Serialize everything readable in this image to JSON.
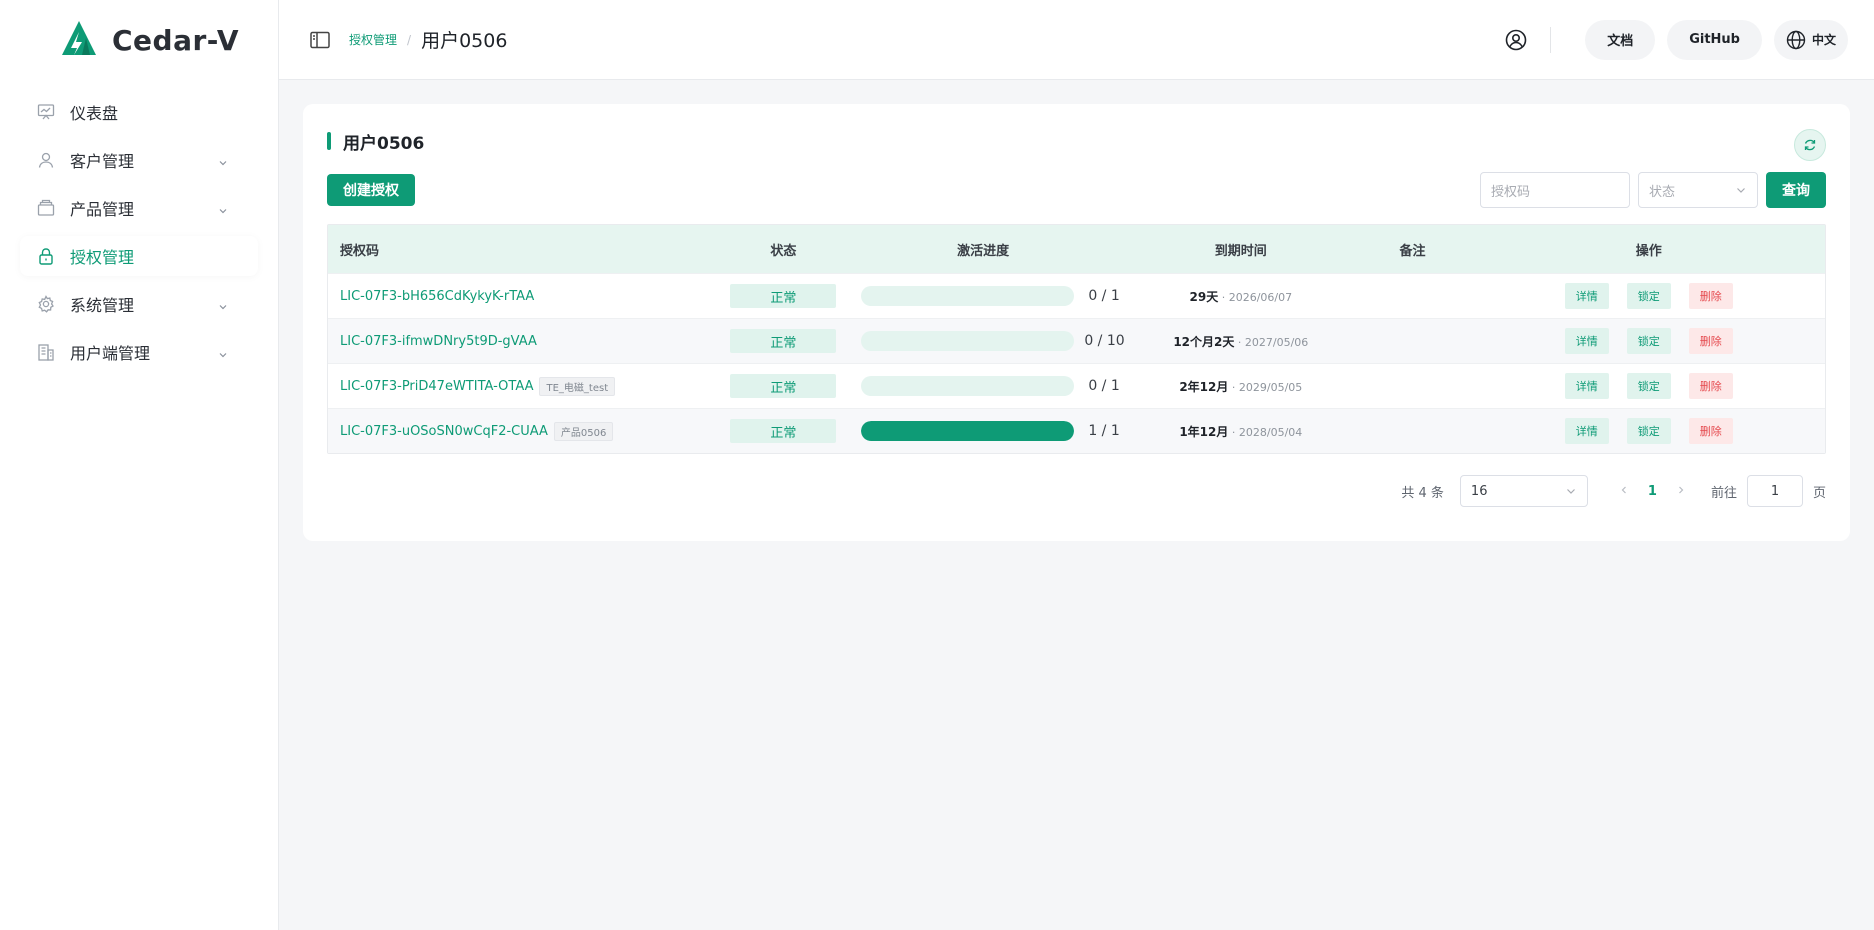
{
  "app": {
    "name": "Cedar-V"
  },
  "sidebar": {
    "items": [
      {
        "label": "仪表盘",
        "icon": "dashboard-icon",
        "expandable": false,
        "active": false
      },
      {
        "label": "客户管理",
        "icon": "user-icon",
        "expandable": true,
        "active": false
      },
      {
        "label": "产品管理",
        "icon": "box-icon",
        "expandable": true,
        "active": false
      },
      {
        "label": "授权管理",
        "icon": "lock-icon",
        "expandable": false,
        "active": true
      },
      {
        "label": "系统管理",
        "icon": "gear-icon",
        "expandable": true,
        "active": false
      },
      {
        "label": "用户端管理",
        "icon": "building-icon",
        "expandable": true,
        "active": false
      }
    ]
  },
  "header": {
    "breadcrumb": {
      "parent": "授权管理",
      "separator": "/",
      "current": "用户0506"
    },
    "docs_label": "文档",
    "github_label": "GitHub",
    "lang_label": "中文"
  },
  "page": {
    "title": "用户0506",
    "create_button": "创建授权",
    "search": {
      "placeholder": "授权码"
    },
    "status_filter": {
      "placeholder": "状态"
    },
    "query_button": "查询"
  },
  "table": {
    "columns": [
      "授权码",
      "状态",
      "激活进度",
      "到期时间",
      "备注",
      "操作"
    ],
    "rows": [
      {
        "code": "LIC-07F3-bH656CdKykyK-rTAA",
        "tag": "",
        "status": "正常",
        "progress_text": "0 / 1",
        "progress": 0,
        "expire_rel": "29天",
        "expire_date": " · 2026/06/07",
        "note": "",
        "ops": [
          "详情",
          "锁定",
          "删除"
        ]
      },
      {
        "code": "LIC-07F3-ifmwDNry5t9D-gVAA",
        "tag": "",
        "status": "正常",
        "progress_text": "0 / 10",
        "progress": 0,
        "expire_rel": "12个月2天",
        "expire_date": " · 2027/05/06",
        "note": "",
        "ops": [
          "详情",
          "锁定",
          "删除"
        ]
      },
      {
        "code": "LIC-07F3-PriD47eWTITA-OTAA",
        "tag": "TE_电磁_test",
        "status": "正常",
        "progress_text": "0 / 1",
        "progress": 0,
        "expire_rel": "2年12月",
        "expire_date": " · 2029/05/05",
        "note": "",
        "ops": [
          "详情",
          "锁定",
          "删除"
        ]
      },
      {
        "code": "LIC-07F3-uOSoSN0wCqF2-CUAA",
        "tag": "产品0506",
        "status": "正常",
        "progress_text": "1 / 1",
        "progress": 1,
        "expire_rel": "1年12月",
        "expire_date": " · 2028/05/04",
        "note": "",
        "ops": [
          "详情",
          "锁定",
          "删除"
        ]
      }
    ]
  },
  "pagination": {
    "total_text": "共 4 条",
    "page_size": "16",
    "current_page": "1",
    "goto_label": "前往",
    "goto_value": "1",
    "page_suffix": "页"
  },
  "colors": {
    "primary": "#0e9b76",
    "danger": "#e5484d"
  }
}
